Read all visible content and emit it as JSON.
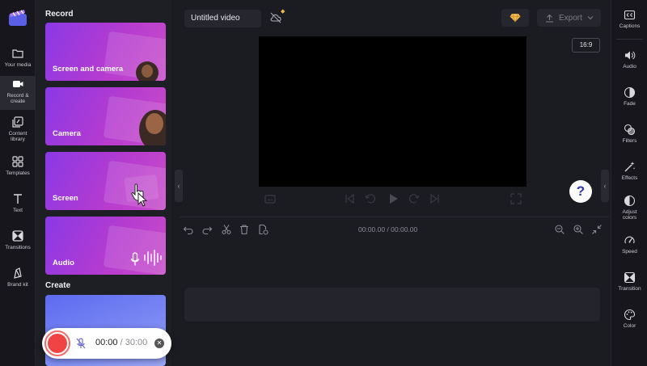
{
  "left_rail": {
    "items": [
      {
        "label": "Your media",
        "icon": "folder-icon"
      },
      {
        "label": "Record &\ncreate",
        "icon": "video-camera-icon",
        "active": true
      },
      {
        "label": "Content\nlibrary",
        "icon": "content-library-icon"
      },
      {
        "label": "Templates",
        "icon": "templates-icon"
      },
      {
        "label": "Text",
        "icon": "text-icon"
      },
      {
        "label": "Transitions",
        "icon": "transitions-icon"
      },
      {
        "label": "Brand kit",
        "icon": "brand-kit-icon"
      }
    ]
  },
  "record_panel": {
    "record_heading": "Record",
    "cards": [
      {
        "label": "Screen and camera"
      },
      {
        "label": "Camera"
      },
      {
        "label": "Screen"
      },
      {
        "label": "Audio"
      }
    ],
    "create_heading": "Create"
  },
  "recorder": {
    "current_time": "00:00",
    "separator": "/",
    "max_time": "30:00"
  },
  "topbar": {
    "video_title": "Untitled video",
    "export_label": "Export"
  },
  "preview": {
    "aspect_ratio": "16:9",
    "help_label": "?"
  },
  "timeline": {
    "time_readout": "00:00.00 / 00:00.00"
  },
  "right_panel": {
    "items": [
      {
        "label": "Captions",
        "icon": "captions-icon"
      },
      {
        "label": "Audio",
        "icon": "speaker-icon"
      },
      {
        "label": "Fade",
        "icon": "fade-icon"
      },
      {
        "label": "Filters",
        "icon": "filters-icon"
      },
      {
        "label": "Effects",
        "icon": "effects-wand-icon"
      },
      {
        "label": "Adjust\ncolors",
        "icon": "adjust-colors-icon"
      },
      {
        "label": "Speed",
        "icon": "speed-gauge-icon"
      },
      {
        "label": "Transition",
        "icon": "transition-icon"
      },
      {
        "label": "Color",
        "icon": "color-palette-icon"
      }
    ]
  },
  "colors": {
    "background": "#1b1b22",
    "accent_purple": "#8a39e6",
    "record_red": "#f04444",
    "premium_gold": "#f2b84b"
  }
}
